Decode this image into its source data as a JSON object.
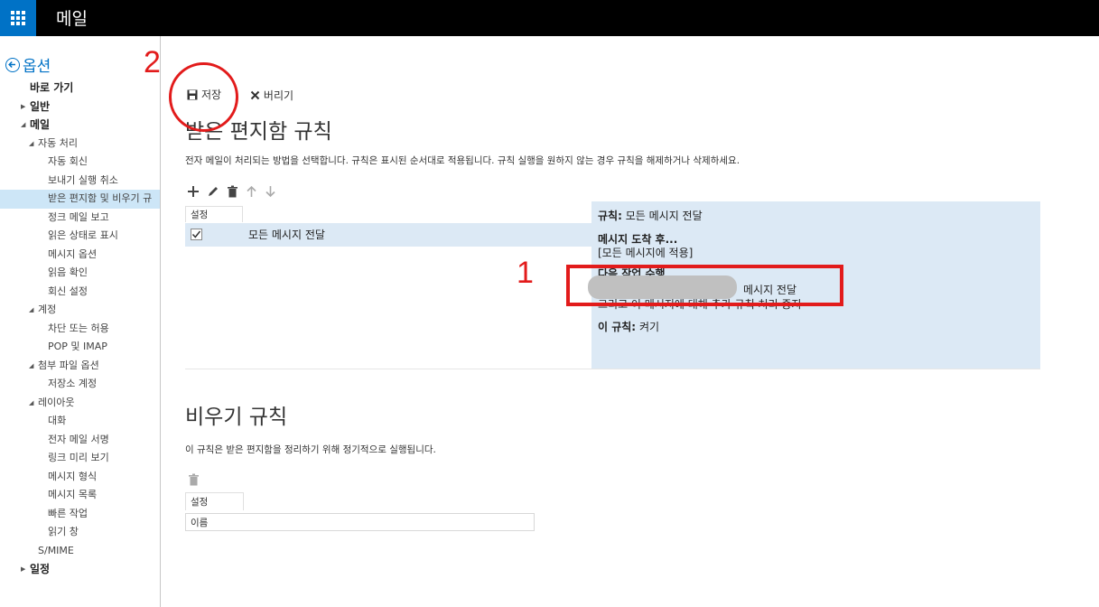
{
  "app": {
    "title": "메일"
  },
  "sidebar": {
    "back_label": "옵션",
    "items": [
      {
        "label": "바로 가기",
        "level": 0,
        "arrow": ""
      },
      {
        "label": "일반",
        "level": 0,
        "arrow": "right"
      },
      {
        "label": "메일",
        "level": 0,
        "arrow": "down"
      },
      {
        "label": "자동 처리",
        "level": 1,
        "arrow": "down"
      },
      {
        "label": "자동 회신",
        "level": 2,
        "arrow": ""
      },
      {
        "label": "보내기 실행 취소",
        "level": 2,
        "arrow": ""
      },
      {
        "label": "받은 편지함 및 비우기 규",
        "level": 2,
        "arrow": "",
        "selected": true
      },
      {
        "label": "정크 메일 보고",
        "level": 2,
        "arrow": ""
      },
      {
        "label": "읽은 상태로 표시",
        "level": 2,
        "arrow": ""
      },
      {
        "label": "메시지 옵션",
        "level": 2,
        "arrow": ""
      },
      {
        "label": "읽음 확인",
        "level": 2,
        "arrow": ""
      },
      {
        "label": "회신 설정",
        "level": 2,
        "arrow": ""
      },
      {
        "label": "계정",
        "level": 1,
        "arrow": "down"
      },
      {
        "label": "차단 또는 허용",
        "level": 2,
        "arrow": ""
      },
      {
        "label": "POP 및 IMAP",
        "level": 2,
        "arrow": ""
      },
      {
        "label": "첨부 파일 옵션",
        "level": 1,
        "arrow": "down"
      },
      {
        "label": "저장소 계정",
        "level": 2,
        "arrow": ""
      },
      {
        "label": "레이아웃",
        "level": 1,
        "arrow": "down"
      },
      {
        "label": "대화",
        "level": 2,
        "arrow": ""
      },
      {
        "label": "전자 메일 서명",
        "level": 2,
        "arrow": ""
      },
      {
        "label": "링크 미리 보기",
        "level": 2,
        "arrow": ""
      },
      {
        "label": "메시지 형식",
        "level": 2,
        "arrow": ""
      },
      {
        "label": "메시지 목록",
        "level": 2,
        "arrow": ""
      },
      {
        "label": "빠른 작업",
        "level": 2,
        "arrow": ""
      },
      {
        "label": "읽기 창",
        "level": 2,
        "arrow": ""
      },
      {
        "label": "S/MIME",
        "level": 1,
        "arrow": ""
      },
      {
        "label": "일정",
        "level": 0,
        "arrow": "right"
      }
    ]
  },
  "toolbar": {
    "save_label": "저장",
    "discard_label": "버리기"
  },
  "inbox_rules": {
    "title": "받은 편지함 규칙",
    "description": "전자 메일이 처리되는 방법을 선택합니다. 규칙은 표시된 순서대로 적용됩니다. 규칙 실행을 원하지 않는 경우 규칙을 해제하거나 삭제하세요.",
    "column_header": "설정",
    "rule_name": "모든 메시지 전달",
    "details": {
      "rule_label": "규칙:",
      "rule_value": "모든 메시지 전달",
      "arrival_label": "메시지 도착 후...",
      "arrival_value": "[모든 메시지에 적용]",
      "action_label": "다음 작업 수행",
      "action_value": "메시지 전달",
      "stop_text": "그리고 이 메시지에 대해 추가 규칙 처리 중지",
      "status_label": "이 규칙:",
      "status_value": "켜기"
    }
  },
  "sweep_rules": {
    "title": "비우기 규칙",
    "description": "이 규칙은 받은 편지함을 정리하기 위해 정기적으로 실행됩니다.",
    "column_header": "설정",
    "name_column": "이름"
  },
  "annotations": {
    "one": "1",
    "two": "2"
  },
  "colors": {
    "accent": "#0072c6",
    "selection": "#dce9f5",
    "annotation": "#e21b1b"
  }
}
